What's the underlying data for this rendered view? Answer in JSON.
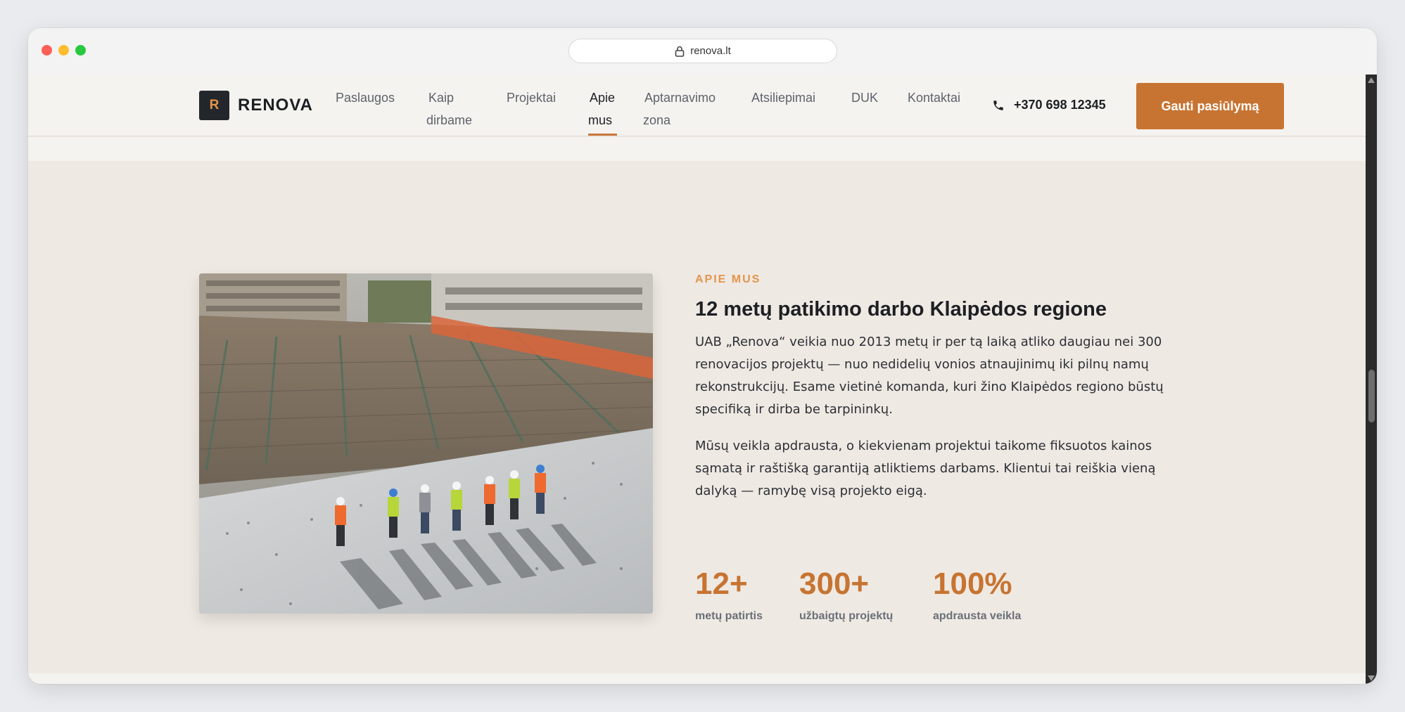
{
  "browser": {
    "url": "renova.lt"
  },
  "brand": {
    "mark": "R",
    "name": "RENOVA"
  },
  "nav": {
    "items": [
      {
        "line1": "Paslaugos",
        "line2": ""
      },
      {
        "line1": "Kaip",
        "line2": "dirbame"
      },
      {
        "line1": "Projektai",
        "line2": ""
      },
      {
        "line1": "Apie",
        "line2": "mus",
        "active": true
      },
      {
        "line1": "Aptarnavimo",
        "line2": "zona"
      },
      {
        "line1": "Atsiliepimai",
        "line2": ""
      },
      {
        "line1": "DUK",
        "line2": ""
      },
      {
        "line1": "Kontaktai",
        "line2": ""
      }
    ],
    "phone": "+370 698 12345",
    "cta": "Gauti pasiūlymą"
  },
  "about": {
    "eyebrow": "APIE MUS",
    "heading": "12 metų patikimo darbo Klaipėdos regione",
    "paragraph1": "UAB „Renova“ veikia nuo 2013 metų ir per tą laiką atliko daugiau nei 300 renovacijos projektų — nuo nedidelių vonios atnaujinimų iki pilnų namų rekonstrukcijų. Esame vietinė komanda, kuri žino Klaipėdos regiono būstų specifiką ir dirba be tarpininkų.",
    "paragraph2": "Mūsų veikla apdrausta, o kiekvienam projektui taikome fiksuotos kainos sąmatą ir raštišką garantiją atliktiems darbams. Klientui tai reiškia vieną dalyką — ramybę visą projekto eigą."
  },
  "stats": [
    {
      "value": "12+",
      "label": "metų patirtis"
    },
    {
      "value": "300+",
      "label": "užbaigtų projektų"
    },
    {
      "value": "100%",
      "label": "apdrausta veikla"
    }
  ],
  "colors": {
    "accent": "#c77432",
    "eyebrow": "#e3954a",
    "section_bg": "#efe9e3",
    "dark": "#1c1f23"
  }
}
